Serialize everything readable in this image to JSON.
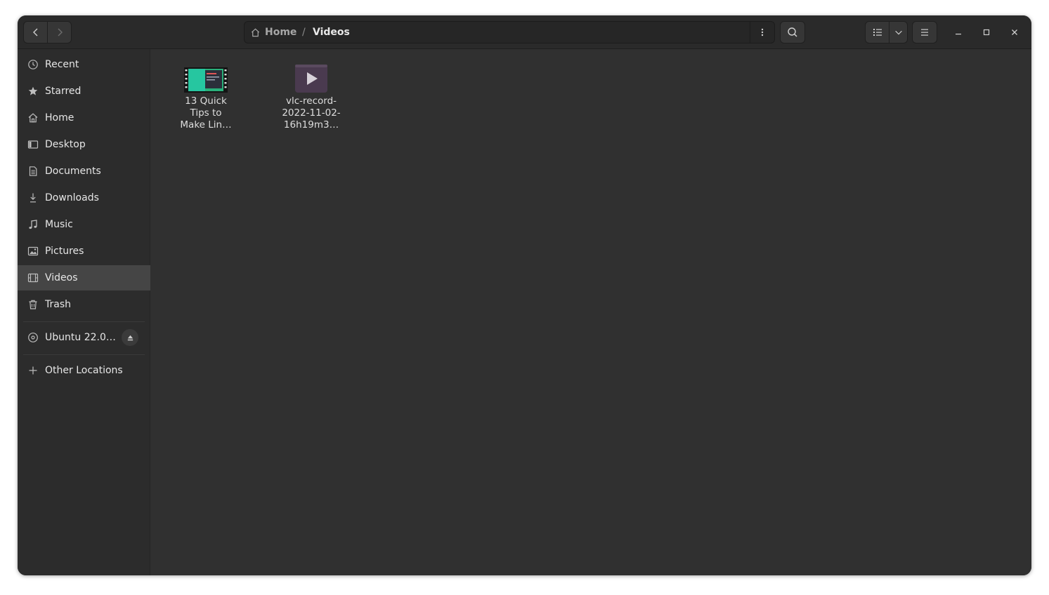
{
  "header": {
    "path": {
      "home_label": "Home",
      "separator": "/",
      "current_label": "Videos"
    }
  },
  "sidebar": {
    "items": [
      {
        "label": "Recent",
        "icon": "clock-icon"
      },
      {
        "label": "Starred",
        "icon": "star-icon"
      },
      {
        "label": "Home",
        "icon": "home-icon"
      },
      {
        "label": "Desktop",
        "icon": "desktop-icon"
      },
      {
        "label": "Documents",
        "icon": "document-icon"
      },
      {
        "label": "Downloads",
        "icon": "download-icon"
      },
      {
        "label": "Music",
        "icon": "music-icon"
      },
      {
        "label": "Pictures",
        "icon": "picture-icon"
      },
      {
        "label": "Videos",
        "icon": "video-icon",
        "active": true
      },
      {
        "label": "Trash",
        "icon": "trash-icon"
      }
    ],
    "drive": {
      "label": "Ubuntu 22.0…",
      "icon": "disc-icon",
      "eject_icon": "eject-icon"
    },
    "other": {
      "label": "Other Locations",
      "icon": "plus-icon"
    }
  },
  "files": [
    {
      "name_lines": [
        "13 Quick",
        "Tips to",
        "Make Lin…"
      ],
      "type": "video-thumbnail"
    },
    {
      "name_lines": [
        "vlc-record-",
        "2022-11-02-",
        "16h19m3…"
      ],
      "type": "video-file-icon"
    }
  ],
  "colors": {
    "window_bg": "#303030",
    "headerbar_bg": "#2a2a2a",
    "sidebar_bg": "#2c2c2c",
    "sidebar_active": "#454545",
    "text": "#e6e6e6",
    "video_icon_bg": "#4a3a4f"
  }
}
